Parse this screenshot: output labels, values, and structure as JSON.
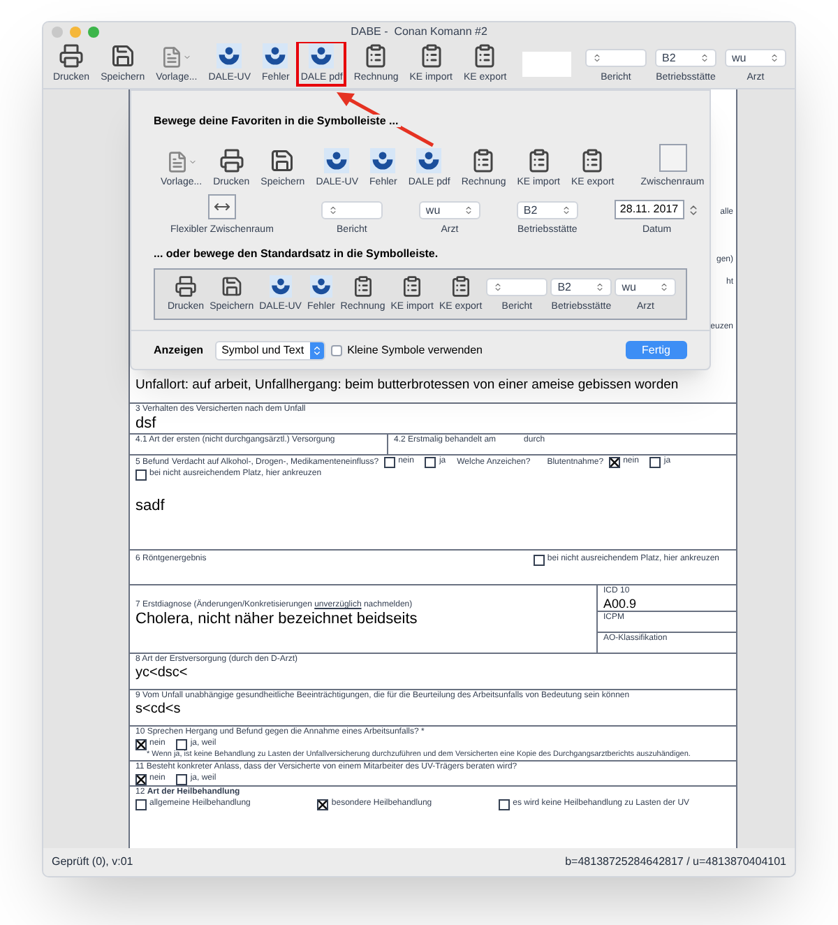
{
  "window": {
    "title": "DABE -  Conan Komann #2"
  },
  "toolbar": {
    "items": [
      {
        "kind": "printer",
        "label": "Drucken",
        "highlighted": false
      },
      {
        "kind": "save",
        "label": "Speichern",
        "highlighted": false
      },
      {
        "kind": "template",
        "label": "Vorlage...",
        "highlighted": false
      },
      {
        "kind": "dale",
        "label": "DALE-UV",
        "highlighted": false
      },
      {
        "kind": "dale",
        "label": "Fehler",
        "highlighted": false
      },
      {
        "kind": "dale",
        "label": "DALE pdf",
        "highlighted": true
      },
      {
        "kind": "clipboard",
        "label": "Rechnung",
        "highlighted": false
      },
      {
        "kind": "clipboard",
        "label": "KE import",
        "highlighted": false
      },
      {
        "kind": "clipboard",
        "label": "KE export",
        "highlighted": false
      },
      {
        "kind": "field",
        "highlighted": false
      },
      {
        "kind": "popup",
        "label": "Bericht",
        "highlighted": false
      },
      {
        "kind": "popup",
        "value": "B2",
        "label": "Betriebsstätte",
        "highlighted": false
      },
      {
        "kind": "popup",
        "value": "wu",
        "label": "Arzt",
        "highlighted": false
      }
    ]
  },
  "customize_sheet": {
    "favorites_heading": "Bewege deine Favoriten in die Symbolleiste ...",
    "favorites_rows": [
      {
        "items": [
          {
            "kind": "template",
            "label": "Vorlage..."
          },
          {
            "kind": "printer",
            "label": "Drucken"
          },
          {
            "kind": "save",
            "label": "Speichern"
          },
          {
            "kind": "dale",
            "label": "DALE-UV"
          },
          {
            "kind": "dale",
            "label": "Fehler"
          },
          {
            "kind": "dale",
            "label": "DALE pdf"
          },
          {
            "kind": "clipboard",
            "label": "Rechnung"
          },
          {
            "kind": "clipboard",
            "label": "KE import"
          },
          {
            "kind": "clipboard",
            "label": "KE export"
          },
          {
            "kind": "space",
            "label": "Zwischenraum"
          }
        ]
      },
      {
        "items": [
          {
            "kind": "flexspace",
            "label": "Flexibler Zwischenraum"
          },
          {
            "kind": "popup",
            "label": "Bericht"
          },
          {
            "kind": "popup",
            "value": "wu",
            "label": "Arzt"
          },
          {
            "kind": "popup",
            "value": "B2",
            "label": "Betriebsstätte"
          },
          {
            "kind": "date",
            "value": "28.11. 2017",
            "label": "Datum"
          }
        ]
      }
    ],
    "default_heading": "... oder bewege den Standardsatz in die Symbolleiste.",
    "default_set": [
      {
        "kind": "printer",
        "label": "Drucken"
      },
      {
        "kind": "save",
        "label": "Speichern"
      },
      {
        "kind": "dale",
        "label": "DALE-UV"
      },
      {
        "kind": "dale",
        "label": "Fehler"
      },
      {
        "kind": "clipboard",
        "label": "Rechnung"
      },
      {
        "kind": "clipboard",
        "label": "KE import"
      },
      {
        "kind": "clipboard",
        "label": "KE export"
      },
      {
        "kind": "popup",
        "label": "Bericht"
      },
      {
        "kind": "popup",
        "value": "B2",
        "label": "Betriebsstätte"
      },
      {
        "kind": "popup",
        "value": "wu",
        "label": "Arzt"
      }
    ],
    "show_label": "Anzeigen",
    "show_select": "Symbol und Text",
    "small_icons": {
      "label": "Kleine Symbole verwenden",
      "checked": false
    },
    "done_button": "Fertig"
  },
  "behind_fragments": [
    "alle",
    "gen)",
    "ht",
    "euzen"
  ],
  "form": {
    "accident_text": "Unfallort: auf arbeit, Unfallhergang: beim butterbrotessen von einer ameise gebissen worden",
    "s3": {
      "label": "3 Verhalten des Versicherten nach dem Unfall",
      "value": "dsf"
    },
    "s4": {
      "label_1": "4.1 Art der ersten (nicht durchgangsärztl.) Versorgung",
      "label_2": "4.2 Erstmalig behandelt am",
      "label_3": "durch"
    },
    "s5": {
      "label": "5 Befund",
      "question_1": "Verdacht auf Alkohol-, Drogen-, Medikamenteneinfluss?",
      "options_1": [
        {
          "label": "nein",
          "checked": false
        },
        {
          "label": "ja",
          "checked": false
        }
      ],
      "question_2": "Welche Anzeichen?",
      "question_3": "Blutentnahme?",
      "options_3": [
        {
          "label": "nein",
          "checked": true
        },
        {
          "label": "ja",
          "checked": false
        }
      ],
      "overflow": {
        "label": "bei nicht ausreichendem Platz, hier ankreuzen",
        "checked": false
      },
      "value": "sadf"
    },
    "s6": {
      "label": "6 Röntgenergebnis",
      "overflow": {
        "label": "bei nicht ausreichendem Platz, hier ankreuzen",
        "checked": false
      }
    },
    "s7": {
      "label_before": "7 Erstdiagnose (Änderungen/Konkretisierungen ",
      "label_underlined": "unverzüglich",
      "label_after": " nachmelden)",
      "value": "Cholera, nicht näher bezeichnet beidseits",
      "codes": [
        {
          "label": "ICD 10",
          "value": "A00.9"
        },
        {
          "label": "ICPM"
        },
        {
          "label": "AO-Klassifikation"
        }
      ]
    },
    "s8": {
      "label": "8 Art der Erstversorgung (durch den D-Arzt)",
      "value": "yc<dsc<"
    },
    "s9": {
      "label": "9 Vom Unfall unabhängige gesundheitliche Beeinträchtigungen, die für die Beurteilung des Arbeitsunfalls von Bedeutung sein können",
      "value": "s<cd<s"
    },
    "s10": {
      "label": "10 Sprechen Hergang und Befund gegen die Annahme eines Arbeitsunfalls? *",
      "options": [
        {
          "label": "nein",
          "checked": true
        },
        {
          "label": "ja, weil",
          "checked": false
        }
      ],
      "note": "* Wenn ja, ist keine Behandlung zu Lasten der Unfallversicherung durchzuführen und dem Versicherten eine Kopie des Durchgangsarztberichts auszuhändigen."
    },
    "s11": {
      "label": "11 Besteht konkreter Anlass, dass der Versicherte von einem Mitarbeiter des UV-Trägers beraten wird?",
      "options": [
        {
          "label": "nein",
          "checked": true
        },
        {
          "label": "ja, weil",
          "checked": false
        }
      ]
    },
    "s12": {
      "label": "12 **Art der Heilbehandlung**",
      "options": [
        {
          "label": "allgemeine Heilbehandlung",
          "checked": false
        },
        {
          "label": "besondere Heilbehandlung",
          "checked": true
        },
        {
          "label": "es wird keine Heilbehandlung zu Lasten der UV",
          "checked": false
        }
      ]
    }
  },
  "status_bar": {
    "left": "Geprüft (0), v:01",
    "right": "b=48138725284642817 / u=4813870404101"
  }
}
